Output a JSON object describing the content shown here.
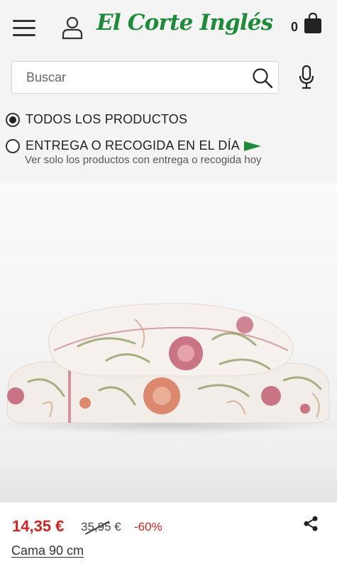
{
  "header": {
    "logo_text": "El Corte Inglés",
    "cart_count": "0",
    "brand_color": "#1e8a3a",
    "icons": [
      "hamburger-menu-icon",
      "user-icon",
      "shopping-bag-icon"
    ]
  },
  "search": {
    "placeholder": "Buscar",
    "value": "",
    "icons": [
      "search-icon",
      "microphone-icon"
    ]
  },
  "filters": {
    "all_products": {
      "label": "TODOS LOS PRODUCTOS",
      "checked": true
    },
    "same_day": {
      "label": "ENTREGA O RECOGIDA EN EL DÍA",
      "subtitle": "Ver solo los productos con entrega o recogida hoy",
      "checked": false,
      "icon": "green-flag-icon"
    }
  },
  "product": {
    "image_description": "floral print duvet cover and pillow set",
    "price": "14,35 €",
    "old_price": "35,95 €",
    "discount": "-60%",
    "name": "Cama 90 cm",
    "price_color": "#c6281f",
    "share_icon": "share-icon"
  }
}
